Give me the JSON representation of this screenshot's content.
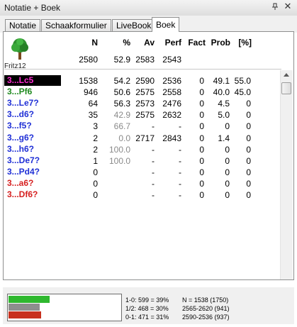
{
  "window": {
    "title": "Notatie + Boek",
    "close_icon": "close-icon",
    "pin_icon": "pin-icon"
  },
  "tabs": [
    "Notatie",
    "Schaakformulier",
    "LiveBook",
    "Boek"
  ],
  "active_tab": "Boek",
  "engine": {
    "name": "Fritz12",
    "icon": "tree-icon"
  },
  "columns": [
    "N",
    "%",
    "Av",
    "Perf",
    "Fact",
    "Prob",
    "[%]"
  ],
  "summary": {
    "n": "2580",
    "pct": "52.9",
    "av": "2583",
    "perf": "2543"
  },
  "moves": [
    {
      "move": "3...Lc5",
      "color": "#ffffff",
      "selected": true,
      "n": "1538",
      "pct": "54.2",
      "av": "2590",
      "perf": "2536",
      "fact": "0",
      "prob": "49.1",
      "prc": "55.0"
    },
    {
      "move": "3...Pf6",
      "color": "#1f8a1f",
      "n": "946",
      "pct": "50.6",
      "av": "2575",
      "perf": "2558",
      "fact": "0",
      "prob": "40.0",
      "prc": "45.0"
    },
    {
      "move": "3...Le7?",
      "color": "#1f2fd6",
      "n": "64",
      "pct": "56.3",
      "av": "2573",
      "perf": "2476",
      "fact": "0",
      "prob": "4.5",
      "prc": "0"
    },
    {
      "move": "3...d6?",
      "color": "#1f2fd6",
      "n": "35",
      "pct": "42.9",
      "pct_grey": true,
      "av": "2575",
      "perf": "2632",
      "fact": "0",
      "prob": "5.0",
      "prc": "0"
    },
    {
      "move": "3...f5?",
      "color": "#1f2fd6",
      "n": "3",
      "pct": "66.7",
      "pct_grey": true,
      "av": "-",
      "perf": "-",
      "fact": "0",
      "prob": "0",
      "prc": "0"
    },
    {
      "move": "3...g6?",
      "color": "#1f2fd6",
      "n": "2",
      "pct": "0.0",
      "pct_grey": true,
      "av": "2717",
      "perf": "2843",
      "fact": "0",
      "prob": "1.4",
      "prc": "0"
    },
    {
      "move": "3...h6?",
      "color": "#1f2fd6",
      "n": "2",
      "pct": "100.0",
      "pct_grey": true,
      "av": "-",
      "perf": "-",
      "fact": "0",
      "prob": "0",
      "prc": "0"
    },
    {
      "move": "3...De7?",
      "color": "#1f2fd6",
      "n": "1",
      "pct": "100.0",
      "pct_grey": true,
      "av": "-",
      "perf": "-",
      "fact": "0",
      "prob": "0",
      "prc": "0"
    },
    {
      "move": "3...Pd4?",
      "color": "#1f2fd6",
      "n": "0",
      "pct": "",
      "av": "-",
      "perf": "-",
      "fact": "0",
      "prob": "0",
      "prc": "0"
    },
    {
      "move": "3...a6?",
      "color": "#d62020",
      "n": "0",
      "pct": "",
      "av": "-",
      "perf": "-",
      "fact": "0",
      "prob": "0",
      "prc": "0"
    },
    {
      "move": "3...Df6?",
      "color": "#d62020",
      "n": "0",
      "pct": "",
      "av": "-",
      "perf": "-",
      "fact": "0",
      "prob": "0",
      "prc": "0"
    }
  ],
  "stats": {
    "result_lines": [
      "1-0: 599 = 39%",
      "1/2: 468 = 30%",
      "0-1: 471 = 31%"
    ],
    "info_lines": [
      "N = 1538 (1750)",
      "2565-2620 (941)",
      "2590-2536 (937)"
    ],
    "bars": [
      {
        "fraction": 0.39,
        "color": "#2fb82f"
      },
      {
        "fraction": 0.3,
        "color": "#8e8e8e"
      },
      {
        "fraction": 0.31,
        "color": "#c8301e"
      }
    ]
  },
  "colors": {
    "selection": "#000000",
    "good_move": "#1f8a1f",
    "dubious_move": "#1f2fd6",
    "bad_move": "#d62020"
  }
}
